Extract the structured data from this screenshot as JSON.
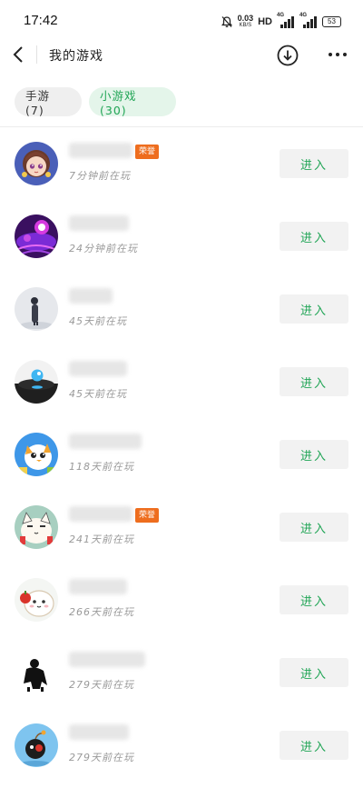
{
  "status_bar": {
    "time": "17:42",
    "net_speed": "0.03",
    "net_unit": "KB/S",
    "hd": "HD",
    "signal1": "4G",
    "signal2": "4G",
    "battery": "53"
  },
  "header": {
    "title": "我的游戏",
    "back_icon": "chevron-left-icon",
    "download_icon": "download-circle-icon",
    "more_icon": "more-dots-icon"
  },
  "tabs": [
    {
      "label": "手游 (7)",
      "active": false
    },
    {
      "label": "小游戏 (30)",
      "active": true
    }
  ],
  "colors": {
    "accent_green": "#21a556",
    "tag_orange": "#ee6d1e"
  },
  "games": [
    {
      "name": "",
      "tag": "荣誉",
      "played": "7分钟前在玩",
      "button": "进入",
      "icon": "anime-girl-icon"
    },
    {
      "name": "",
      "tag": "",
      "played": "24分钟前在玩",
      "button": "进入",
      "icon": "music-tiles-icon"
    },
    {
      "name": "",
      "tag": "",
      "played": "45天前在玩",
      "button": "进入",
      "icon": "dark-figure-icon"
    },
    {
      "name": "",
      "tag": "",
      "played": "45天前在玩",
      "button": "进入",
      "icon": "ball-jump-icon"
    },
    {
      "name": "",
      "tag": "",
      "played": "118天前在玩",
      "button": "进入",
      "icon": "cartoon-bird-icon"
    },
    {
      "name": "",
      "tag": "荣誉",
      "played": "241天前在玩",
      "button": "进入",
      "icon": "cartoon-cat-icon"
    },
    {
      "name": "",
      "tag": "",
      "played": "266天前在玩",
      "button": "进入",
      "icon": "cartoon-hamster-icon"
    },
    {
      "name": "",
      "tag": "",
      "played": "279天前在玩",
      "button": "进入",
      "icon": "silhouette-icon"
    },
    {
      "name": "",
      "tag": "",
      "played": "279天前在玩",
      "button": "进入",
      "icon": "bomb-bird-icon"
    }
  ]
}
